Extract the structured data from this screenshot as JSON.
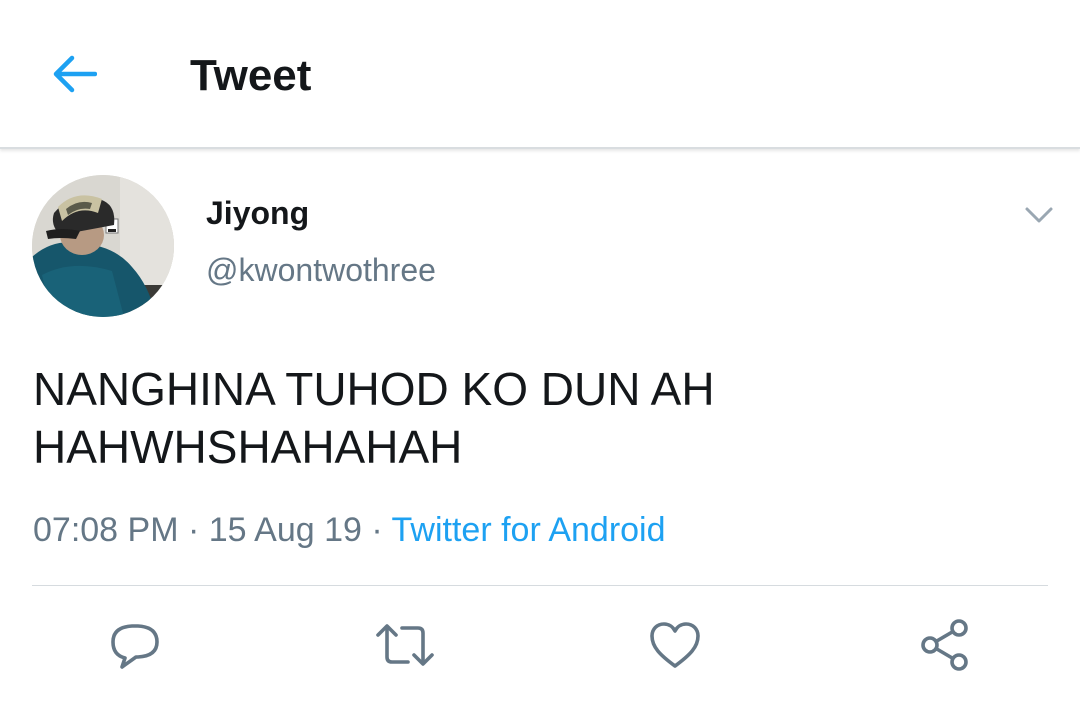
{
  "header": {
    "title": "Tweet",
    "back_icon": "arrow-left-icon"
  },
  "author": {
    "display_name": "Jiyong",
    "handle": "@kwontwothree",
    "avatar_icon": "avatar-photo"
  },
  "tweet": {
    "lines": [
      "NANGHINA TUHOD KO DUN AH",
      "HAHWHSHAHAHAH"
    ],
    "time": "07:08 PM",
    "date": "15 Aug 19",
    "separator": " · ",
    "source": "Twitter for Android"
  },
  "actions": [
    {
      "icon": "reply-icon"
    },
    {
      "icon": "retweet-icon"
    },
    {
      "icon": "like-icon"
    },
    {
      "icon": "share-icon"
    }
  ],
  "colors": {
    "accent": "#1da1f2",
    "text_primary": "#14171a",
    "text_secondary": "#657786",
    "icon_gray": "#657786",
    "divider": "#d6dbdf"
  }
}
